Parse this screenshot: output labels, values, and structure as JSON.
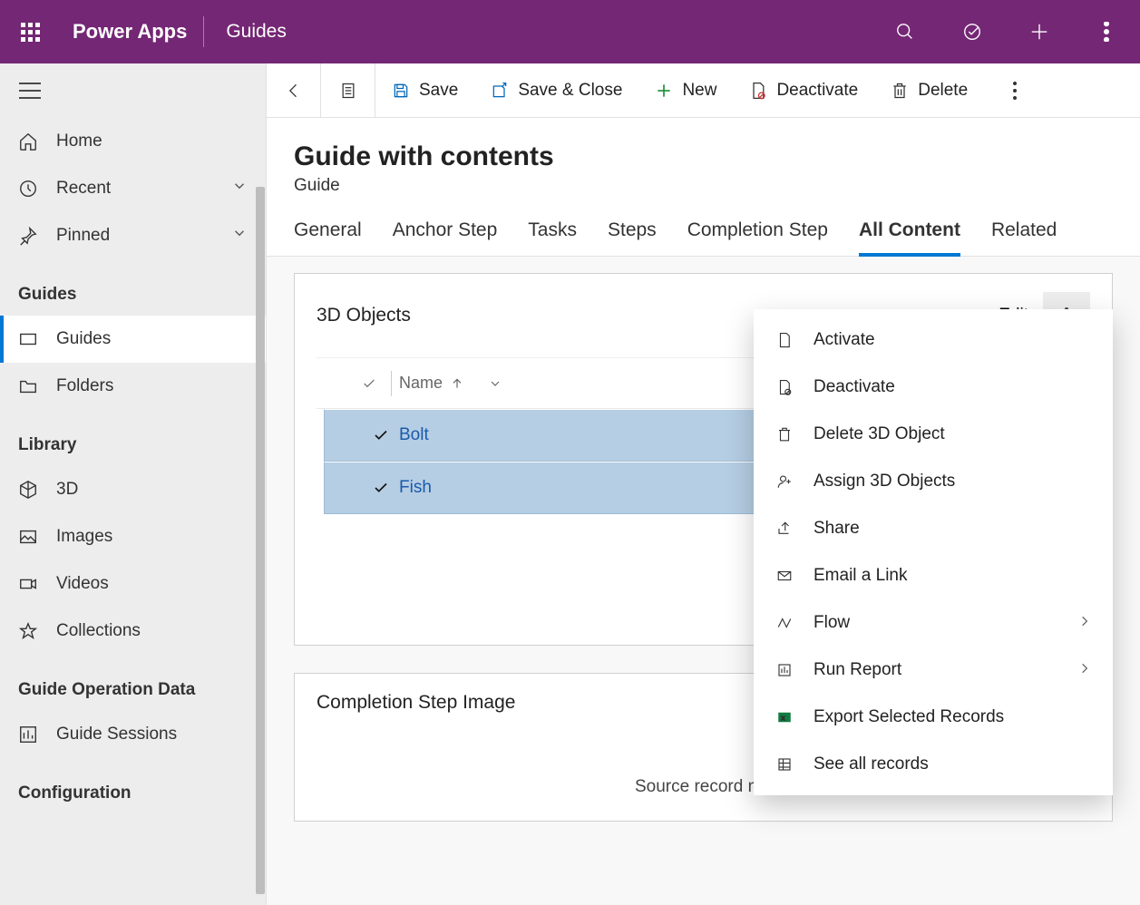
{
  "topbar": {
    "brand": "Power Apps",
    "app": "Guides"
  },
  "sidenav": {
    "home": "Home",
    "recent": "Recent",
    "pinned": "Pinned",
    "section_guides": "Guides",
    "guides": "Guides",
    "folders": "Folders",
    "section_library": "Library",
    "threed": "3D",
    "images": "Images",
    "videos": "Videos",
    "collections": "Collections",
    "section_opdata": "Guide Operation Data",
    "sessions": "Guide Sessions",
    "section_config": "Configuration"
  },
  "cmdbar": {
    "save": "Save",
    "save_close": "Save & Close",
    "new": "New",
    "deactivate": "Deactivate",
    "delete": "Delete"
  },
  "header": {
    "title": "Guide with contents",
    "subtitle": "Guide"
  },
  "tabs": {
    "general": "General",
    "anchor": "Anchor Step",
    "tasks": "Tasks",
    "steps": "Steps",
    "completion": "Completion Step",
    "all_content": "All Content",
    "related": "Related"
  },
  "section1": {
    "title": "3D Objects",
    "edit": "Edit",
    "col_name": "Name",
    "rows": [
      "Bolt",
      "Fish"
    ]
  },
  "section2": {
    "title": "Completion Step Image",
    "msg": "Source record not"
  },
  "menu": {
    "activate": "Activate",
    "deactivate": "Deactivate",
    "delete3d": "Delete 3D Object",
    "assign": "Assign 3D Objects",
    "share": "Share",
    "email": "Email a Link",
    "flow": "Flow",
    "runreport": "Run Report",
    "export": "Export Selected Records",
    "seeall": "See all records"
  }
}
